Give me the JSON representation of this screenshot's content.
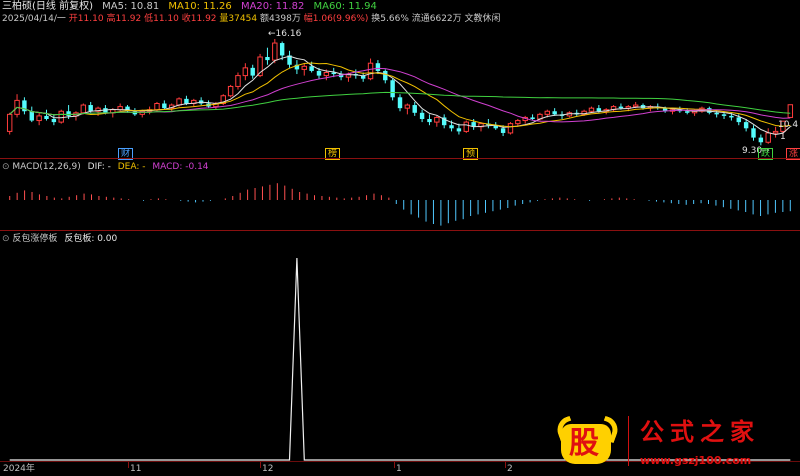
{
  "header": {
    "stock_name": "三柏硕(日线 前复权)",
    "ma": [
      {
        "label": "MA5: 10.81",
        "color": "#e0e0e0"
      },
      {
        "label": "MA10: 11.26",
        "color": "#f0c000"
      },
      {
        "label": "MA20: 11.82",
        "color": "#d040d0"
      },
      {
        "label": "MA60: 11.94",
        "color": "#40d040"
      }
    ],
    "date": "2025/04/14/一",
    "open_label": "开",
    "open": "11.10",
    "high_label": "高",
    "high": "11.92",
    "low_label": "低",
    "low": "11.10",
    "close_label": "收",
    "close": "11.92",
    "vol_label": "量",
    "vol": "37454",
    "amt_label": "额",
    "amt": "4398万",
    "chg_label": "幅",
    "chg": "1.06(9.96%)",
    "turn": "换5.66%",
    "float": "流通6622万",
    "tag": "文教休闲"
  },
  "annotations": {
    "high_price": "16.16",
    "low_price": "9.30",
    "right_price_1": "10.4",
    "right_price_2": "1"
  },
  "event_markers": [
    {
      "label": "财",
      "color": "#4aa0ff"
    },
    {
      "label": "榜",
      "color": "#f0c000"
    },
    {
      "label": "预",
      "color": "#f0c000"
    },
    {
      "label": "跌",
      "color": "#40d040"
    },
    {
      "label": "涨",
      "color": "#ff4040"
    }
  ],
  "macd_panel": {
    "title": "MACD(12,26,9)",
    "dif": "DIF: -",
    "dea": "DEA: -",
    "macd": "MACD: -0.14"
  },
  "indicator_panel": {
    "title": "反包涨停板",
    "value": "反包板: 0.00"
  },
  "time_axis": [
    "2024年",
    "11",
    "12",
    "1",
    "2"
  ],
  "watermark": {
    "logo_char": "股",
    "text": [
      "公",
      "式",
      "之",
      "家"
    ],
    "url": "www.gszj100.com"
  },
  "colors": {
    "up": "#ff3c3c",
    "down": "#54fcfc",
    "ma5": "#e0e0e0",
    "ma10": "#f0c000",
    "ma20": "#d040d0",
    "ma60": "#40d040",
    "macd_pos": "#ff5050",
    "macd_neg": "#50c8ff"
  },
  "chart_data": [
    {
      "type": "candlestick",
      "title": "三柏硕(日线 前复权)",
      "xlabel": "",
      "ylabel": "",
      "ylim": [
        9.0,
        17.0
      ],
      "candles": [
        [
          10.2,
          11.4,
          10.0,
          11.3
        ],
        [
          11.3,
          12.6,
          11.1,
          12.2
        ],
        [
          12.2,
          12.4,
          11.3,
          11.5
        ],
        [
          11.5,
          11.8,
          10.8,
          10.9
        ],
        [
          10.9,
          11.4,
          10.6,
          11.2
        ],
        [
          11.2,
          11.6,
          10.9,
          11.0
        ],
        [
          11.0,
          11.3,
          10.6,
          10.8
        ],
        [
          10.8,
          11.6,
          10.7,
          11.5
        ],
        [
          11.5,
          11.9,
          11.0,
          11.2
        ],
        [
          11.2,
          11.5,
          10.9,
          11.4
        ],
        [
          11.4,
          12.0,
          11.3,
          11.9
        ],
        [
          11.9,
          12.1,
          11.4,
          11.5
        ],
        [
          11.5,
          11.8,
          11.2,
          11.7
        ],
        [
          11.7,
          11.9,
          11.3,
          11.4
        ],
        [
          11.4,
          11.7,
          11.1,
          11.6
        ],
        [
          11.6,
          12.0,
          11.5,
          11.8
        ],
        [
          11.8,
          11.9,
          11.4,
          11.5
        ],
        [
          11.5,
          11.7,
          11.2,
          11.3
        ],
        [
          11.3,
          11.6,
          11.1,
          11.5
        ],
        [
          11.5,
          11.8,
          11.3,
          11.6
        ],
        [
          11.6,
          12.1,
          11.5,
          12.0
        ],
        [
          12.0,
          12.2,
          11.6,
          11.7
        ],
        [
          11.7,
          12.0,
          11.5,
          11.9
        ],
        [
          11.9,
          12.4,
          11.8,
          12.3
        ],
        [
          12.3,
          12.5,
          11.9,
          12.0
        ],
        [
          12.0,
          12.3,
          11.8,
          12.2
        ],
        [
          12.2,
          12.4,
          11.9,
          12.0
        ],
        [
          12.0,
          12.2,
          11.7,
          11.8
        ],
        [
          11.8,
          12.1,
          11.6,
          12.0
        ],
        [
          12.0,
          12.6,
          11.9,
          12.5
        ],
        [
          12.5,
          13.2,
          12.4,
          13.1
        ],
        [
          13.1,
          14.0,
          12.9,
          13.8
        ],
        [
          13.8,
          14.6,
          13.5,
          14.3
        ],
        [
          14.3,
          14.5,
          13.6,
          13.8
        ],
        [
          13.8,
          15.2,
          13.7,
          15.0
        ],
        [
          15.0,
          15.6,
          14.5,
          14.8
        ],
        [
          14.8,
          16.16,
          14.6,
          15.9
        ],
        [
          15.9,
          16.0,
          14.8,
          15.1
        ],
        [
          15.1,
          15.4,
          14.3,
          14.5
        ],
        [
          14.5,
          14.8,
          13.9,
          14.2
        ],
        [
          14.2,
          14.6,
          13.8,
          14.4
        ],
        [
          14.4,
          14.7,
          14.0,
          14.1
        ],
        [
          14.1,
          14.3,
          13.6,
          13.8
        ],
        [
          13.8,
          14.2,
          13.5,
          14.0
        ],
        [
          14.0,
          14.3,
          13.7,
          13.9
        ],
        [
          13.9,
          14.1,
          13.5,
          13.7
        ],
        [
          13.7,
          14.0,
          13.4,
          13.9
        ],
        [
          13.9,
          14.2,
          13.6,
          13.8
        ],
        [
          13.8,
          14.0,
          13.4,
          13.6
        ],
        [
          13.6,
          14.9,
          13.5,
          14.6
        ],
        [
          14.6,
          14.8,
          13.9,
          14.1
        ],
        [
          14.1,
          14.2,
          13.3,
          13.5
        ],
        [
          13.5,
          13.6,
          12.2,
          12.4
        ],
        [
          12.4,
          12.6,
          11.5,
          11.7
        ],
        [
          11.7,
          12.0,
          11.3,
          11.9
        ],
        [
          11.9,
          12.1,
          11.2,
          11.4
        ],
        [
          11.4,
          11.6,
          10.8,
          11.0
        ],
        [
          11.0,
          11.3,
          10.6,
          10.8
        ],
        [
          10.8,
          11.2,
          10.5,
          11.1
        ],
        [
          11.1,
          11.3,
          10.4,
          10.6
        ],
        [
          10.6,
          10.9,
          10.2,
          10.4
        ],
        [
          10.4,
          10.7,
          10.0,
          10.2
        ],
        [
          10.2,
          10.9,
          10.1,
          10.8
        ],
        [
          10.8,
          11.0,
          10.3,
          10.5
        ],
        [
          10.5,
          10.8,
          10.2,
          10.7
        ],
        [
          10.7,
          11.0,
          10.4,
          10.6
        ],
        [
          10.6,
          10.8,
          10.3,
          10.4
        ],
        [
          10.4,
          10.6,
          9.9,
          10.1
        ],
        [
          10.1,
          10.8,
          10.0,
          10.7
        ],
        [
          10.7,
          11.0,
          10.5,
          10.9
        ],
        [
          10.9,
          11.2,
          10.7,
          11.1
        ],
        [
          11.1,
          11.3,
          10.9,
          11.0
        ],
        [
          11.0,
          11.4,
          10.9,
          11.3
        ],
        [
          11.3,
          11.6,
          11.1,
          11.5
        ],
        [
          11.5,
          11.7,
          11.2,
          11.3
        ],
        [
          11.3,
          11.5,
          11.0,
          11.2
        ],
        [
          11.2,
          11.5,
          11.1,
          11.4
        ],
        [
          11.4,
          11.6,
          11.2,
          11.3
        ],
        [
          11.3,
          11.6,
          11.2,
          11.5
        ],
        [
          11.5,
          11.8,
          11.4,
          11.7
        ],
        [
          11.7,
          11.9,
          11.4,
          11.5
        ],
        [
          11.5,
          11.7,
          11.3,
          11.6
        ],
        [
          11.6,
          11.9,
          11.5,
          11.8
        ],
        [
          11.8,
          12.0,
          11.6,
          11.7
        ],
        [
          11.7,
          11.9,
          11.5,
          11.8
        ],
        [
          11.8,
          12.1,
          11.7,
          11.9
        ],
        [
          11.9,
          12.0,
          11.6,
          11.7
        ],
        [
          11.7,
          11.9,
          11.5,
          11.8
        ],
        [
          11.8,
          12.0,
          11.6,
          11.7
        ],
        [
          11.7,
          11.8,
          11.4,
          11.5
        ],
        [
          11.5,
          11.7,
          11.3,
          11.6
        ],
        [
          11.6,
          11.8,
          11.4,
          11.5
        ],
        [
          11.5,
          11.7,
          11.3,
          11.4
        ],
        [
          11.4,
          11.6,
          11.2,
          11.5
        ],
        [
          11.5,
          11.8,
          11.4,
          11.7
        ],
        [
          11.7,
          11.8,
          11.3,
          11.4
        ],
        [
          11.4,
          11.6,
          11.1,
          11.3
        ],
        [
          11.3,
          11.5,
          11.0,
          11.2
        ],
        [
          11.2,
          11.4,
          10.9,
          11.1
        ],
        [
          11.1,
          11.3,
          10.6,
          10.8
        ],
        [
          10.8,
          11.0,
          10.2,
          10.4
        ],
        [
          10.4,
          10.6,
          9.6,
          9.8
        ],
        [
          9.8,
          10.0,
          9.3,
          9.5
        ],
        [
          9.5,
          10.4,
          9.4,
          10.1
        ],
        [
          10.1,
          10.5,
          9.8,
          10.2
        ],
        [
          10.2,
          10.5,
          9.9,
          10.86
        ],
        [
          11.1,
          11.92,
          11.1,
          11.92
        ]
      ],
      "ma_params": [
        5,
        10,
        20,
        60
      ]
    },
    {
      "type": "bar",
      "title": "MACD(12,26,9)",
      "xlabel": "",
      "ylabel": "",
      "values": [
        0.05,
        0.09,
        0.12,
        0.1,
        0.07,
        0.05,
        0.03,
        0.02,
        0.04,
        0.06,
        0.08,
        0.07,
        0.05,
        0.04,
        0.03,
        0.02,
        0.01,
        0.0,
        -0.01,
        0.01,
        0.02,
        0.01,
        0.0,
        -0.01,
        -0.02,
        -0.03,
        -0.02,
        -0.01,
        0.0,
        0.02,
        0.05,
        0.09,
        0.13,
        0.15,
        0.17,
        0.19,
        0.21,
        0.18,
        0.14,
        0.1,
        0.08,
        0.06,
        0.05,
        0.04,
        0.03,
        0.02,
        0.03,
        0.04,
        0.06,
        0.08,
        0.06,
        0.03,
        -0.05,
        -0.12,
        -0.18,
        -0.22,
        -0.27,
        -0.3,
        -0.32,
        -0.29,
        -0.26,
        -0.24,
        -0.2,
        -0.18,
        -0.16,
        -0.14,
        -0.12,
        -0.1,
        -0.07,
        -0.05,
        -0.03,
        -0.01,
        0.01,
        0.02,
        0.03,
        0.02,
        0.01,
        0.0,
        -0.01,
        0.0,
        0.01,
        0.02,
        0.03,
        0.02,
        0.01,
        0.0,
        -0.01,
        -0.02,
        -0.03,
        -0.04,
        -0.05,
        -0.06,
        -0.05,
        -0.04,
        -0.05,
        -0.07,
        -0.09,
        -0.11,
        -0.13,
        -0.15,
        -0.18,
        -0.2,
        -0.18,
        -0.16,
        -0.15,
        -0.14
      ],
      "ylim": [
        -0.35,
        0.35
      ]
    },
    {
      "type": "line",
      "title": "反包涨停板",
      "xlabel": "",
      "ylabel": "",
      "values_index_spike": 39,
      "values": "0 everywhere except a single spike of 1 at index 39",
      "ylim": [
        0,
        1
      ]
    }
  ]
}
